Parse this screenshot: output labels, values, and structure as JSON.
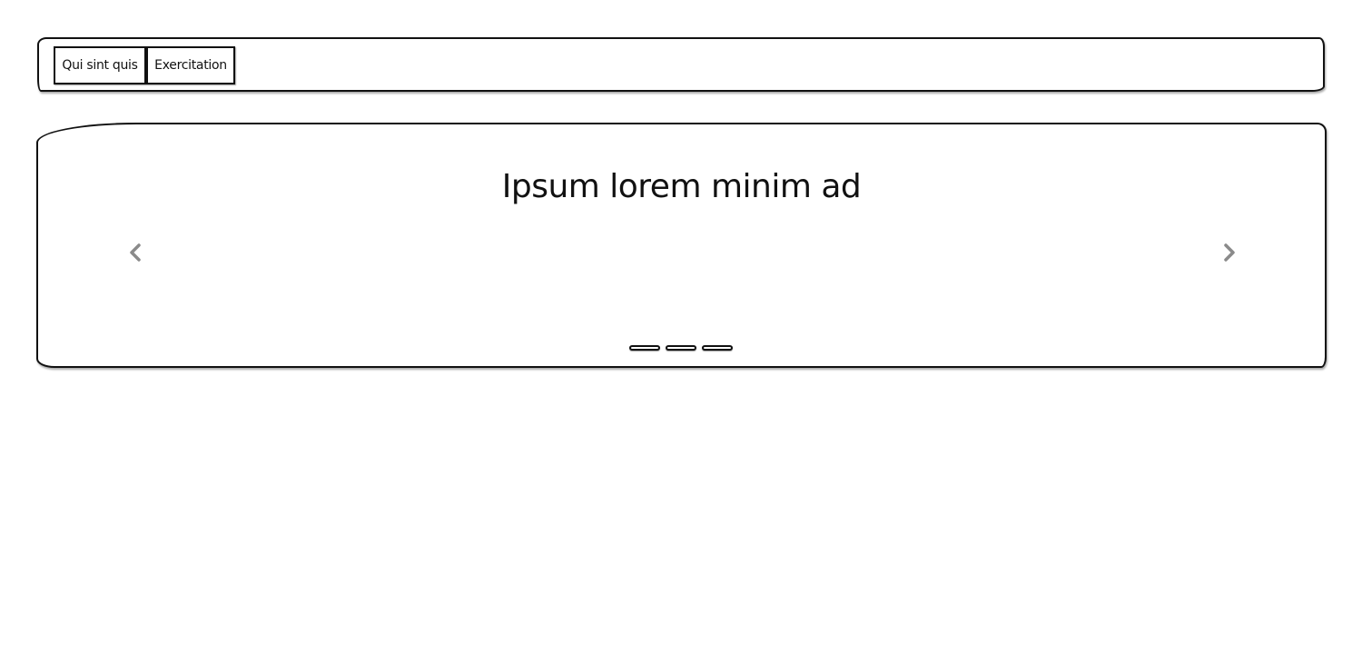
{
  "navbar": {
    "buttons": [
      {
        "label": "Qui sint quis"
      },
      {
        "label": "Exercitation"
      }
    ]
  },
  "carousel": {
    "title": "Ipsum lorem minim ad",
    "prev_icon": "chevron-left-icon",
    "next_icon": "chevron-right-icon",
    "indicator_count": 3,
    "colors": {
      "chevron": "#8a8a8a",
      "outline": "#111111"
    }
  }
}
